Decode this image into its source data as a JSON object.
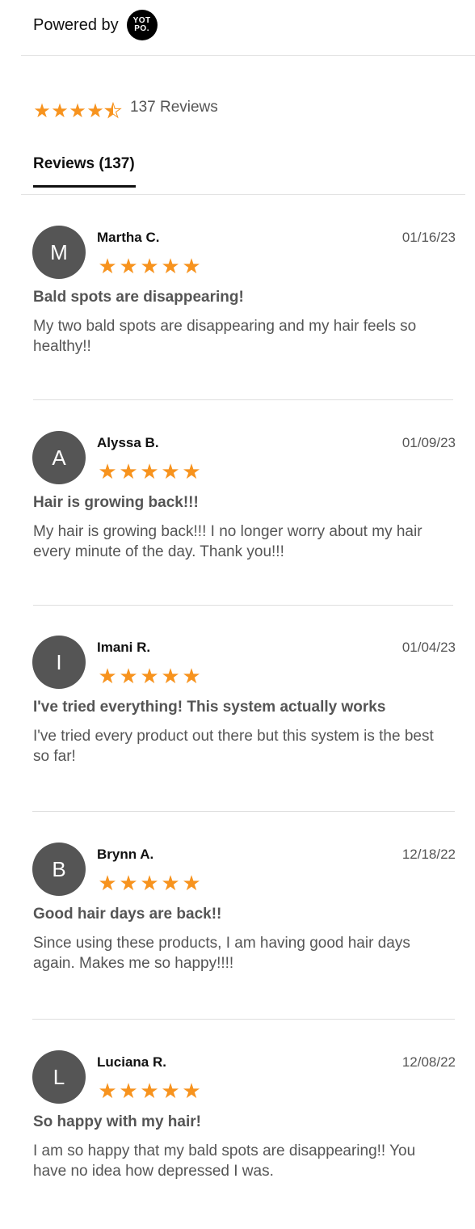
{
  "header": {
    "powered_by": "Powered by",
    "logo_line1": "YOT",
    "logo_line2": "PO."
  },
  "summary": {
    "rating": 4.5,
    "count_text": "137 Reviews",
    "star_color": "#f7931e"
  },
  "tabs": [
    {
      "label": "Reviews (137)",
      "active": true
    }
  ],
  "reviews": [
    {
      "initial": "M",
      "author": "Martha C.",
      "date": "01/16/23",
      "rating": 5,
      "title": "Bald spots are disappearing!",
      "body": "My two bald spots are disappearing and my hair feels so healthy!!"
    },
    {
      "initial": "A",
      "author": "Alyssa B.",
      "date": "01/09/23",
      "rating": 5,
      "title": "Hair is growing back!!!",
      "body": "My hair is growing back!!! I no longer worry about my hair every minute of the day. Thank you!!!"
    },
    {
      "initial": "I",
      "author": "Imani R.",
      "date": "01/04/23",
      "rating": 5,
      "title": "I've tried everything! This system actually works",
      "body": "I've tried every product out there but this system is the best so far!"
    },
    {
      "initial": "B",
      "author": "Brynn A.",
      "date": "12/18/22",
      "rating": 5,
      "title": "Good hair days are back!!",
      "body": "Since using these products, I am having good hair days again. Makes me so happy!!!!"
    },
    {
      "initial": "L",
      "author": "Luciana R.",
      "date": "12/08/22",
      "rating": 5,
      "title": "So happy with my hair!",
      "body": "I am so happy that my bald spots are disappearing!! You have no idea how depressed I was."
    }
  ],
  "colors": {
    "star": "#f7931e",
    "avatar_bg": "#555555",
    "text_muted": "#555555"
  }
}
